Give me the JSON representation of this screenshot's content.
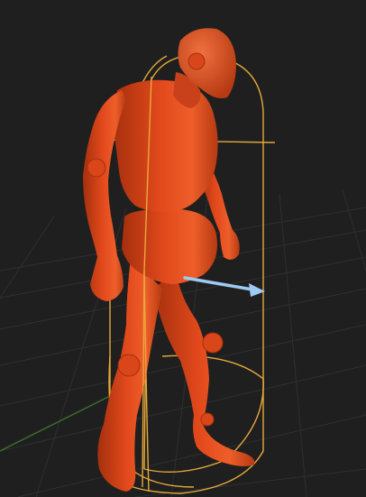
{
  "viewport": {
    "background_color": "#1f1f1f",
    "grid_line_color": "#3a3a3a",
    "grid_axis_color": "#3f6b2f"
  },
  "character": {
    "material_color": "#e2491c",
    "material_shadow_color": "#a5300d",
    "material_highlight_color": "#f0703f"
  },
  "capsule_collider": {
    "color": "#e7a93a"
  },
  "gizmo": {
    "name": "direction-arrow-icon",
    "color": "#9ec9f2"
  }
}
